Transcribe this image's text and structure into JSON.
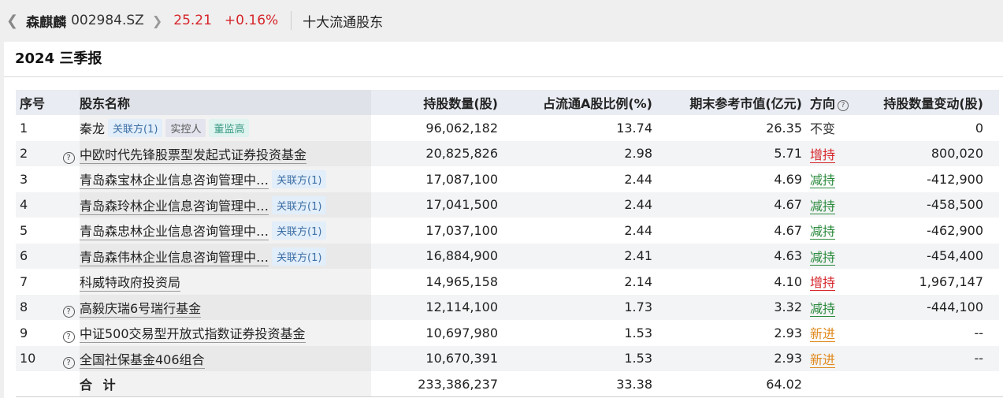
{
  "header": {
    "stock_name": "森麒麟",
    "stock_code": "002984.SZ",
    "price": "25.21",
    "change_pct": "+0.16%",
    "section_title": "十大流通股东"
  },
  "report": {
    "period": "2024 三季报"
  },
  "table": {
    "columns": {
      "rank": "序号",
      "holder": "股东名称",
      "shares": "持股数量(股)",
      "ratio": "占流通A股比例(%)",
      "value": "期末参考市值(亿元)",
      "direction": "方向",
      "change": "持股数量变动(股)"
    },
    "rows": [
      {
        "rank": "1",
        "q": "",
        "holder": "秦龙",
        "underline": false,
        "tags": [
          "关联方(1)",
          "实控人",
          "董监高"
        ],
        "shares": "96,062,182",
        "ratio": "13.74",
        "value": "26.35",
        "direction": "不变",
        "change": "0"
      },
      {
        "rank": "2",
        "q": "?",
        "holder": "中欧时代先锋股票型发起式证券投资基金",
        "underline": true,
        "tags": [],
        "shares": "20,825,826",
        "ratio": "2.98",
        "value": "5.71",
        "direction": "增持",
        "change": "800,020"
      },
      {
        "rank": "3",
        "q": "",
        "holder": "青岛森宝林企业信息咨询管理中…",
        "underline": true,
        "tags": [
          "关联方(1)"
        ],
        "shares": "17,087,100",
        "ratio": "2.44",
        "value": "4.69",
        "direction": "减持",
        "change": "-412,900"
      },
      {
        "rank": "4",
        "q": "",
        "holder": "青岛森玲林企业信息咨询管理中…",
        "underline": true,
        "tags": [
          "关联方(1)"
        ],
        "shares": "17,041,500",
        "ratio": "2.44",
        "value": "4.67",
        "direction": "减持",
        "change": "-458,500"
      },
      {
        "rank": "5",
        "q": "",
        "holder": "青岛森忠林企业信息咨询管理中…",
        "underline": true,
        "tags": [
          "关联方(1)"
        ],
        "shares": "17,037,100",
        "ratio": "2.44",
        "value": "4.67",
        "direction": "减持",
        "change": "-462,900"
      },
      {
        "rank": "6",
        "q": "",
        "holder": "青岛森伟林企业信息咨询管理中…",
        "underline": true,
        "tags": [
          "关联方(1)"
        ],
        "shares": "16,884,900",
        "ratio": "2.41",
        "value": "4.63",
        "direction": "减持",
        "change": "-454,400"
      },
      {
        "rank": "7",
        "q": "",
        "holder": "科威特政府投资局",
        "underline": true,
        "tags": [],
        "shares": "14,965,158",
        "ratio": "2.14",
        "value": "4.10",
        "direction": "增持",
        "change": "1,967,147"
      },
      {
        "rank": "8",
        "q": "?",
        "holder": "高毅庆瑞6号瑞行基金",
        "underline": true,
        "tags": [],
        "shares": "12,114,100",
        "ratio": "1.73",
        "value": "3.32",
        "direction": "减持",
        "change": "-444,100"
      },
      {
        "rank": "9",
        "q": "?",
        "holder": "中证500交易型开放式指数证券投资基金",
        "underline": true,
        "tags": [],
        "shares": "10,697,980",
        "ratio": "1.53",
        "value": "2.93",
        "direction": "新进",
        "change": "--"
      },
      {
        "rank": "10",
        "q": "?",
        "holder": "全国社保基金406组合",
        "underline": true,
        "tags": [],
        "shares": "10,670,391",
        "ratio": "1.53",
        "value": "2.93",
        "direction": "新进",
        "change": "--"
      }
    ],
    "total": {
      "label": "合 计",
      "shares": "233,386,237",
      "ratio": "33.38",
      "value": "64.02"
    }
  },
  "colors": {
    "up": "#d6262b",
    "down": "#2a8a3c",
    "new": "#e08a1e"
  }
}
